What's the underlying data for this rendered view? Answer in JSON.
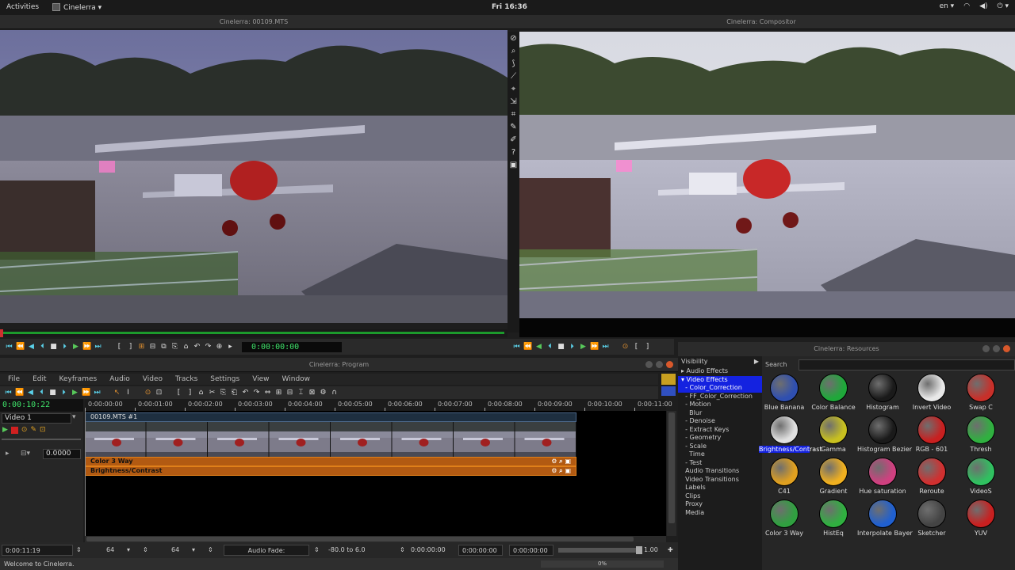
{
  "topbar": {
    "activities": "Activities",
    "app": "Cinelerra ▾",
    "clock": "Fri 16:36",
    "lang": "en ▾",
    "tray_icons": [
      "wifi-icon",
      "volume-icon",
      "power-icon"
    ]
  },
  "viewer": {
    "title": "Cinelerra: 00109.MTS",
    "timecode": "0:00:00:00"
  },
  "compositor": {
    "title": "Cinelerra: Compositor"
  },
  "program": {
    "title": "Cinelerra: Program",
    "menu": [
      "File",
      "Edit",
      "Keyframes",
      "Audio",
      "Video",
      "Tracks",
      "Settings",
      "View",
      "Window"
    ],
    "position": "0:00:10:22",
    "ruler_labels": [
      "0:00:00:00",
      "0:00:01:00",
      "0:00:02:00",
      "0:00:03:00",
      "0:00:04:00",
      "0:00:05:00",
      "0:00:06:00",
      "0:00:07:00",
      "0:00:08:00",
      "0:00:09:00",
      "0:00:10:00",
      "0:00:11:00"
    ],
    "track": {
      "name": "Video 1",
      "fade": "0.0000",
      "clip_title": "00109.MTS #1",
      "effects": [
        "Color 3 Way",
        "Brightness/Contrast"
      ]
    },
    "status": {
      "duration": "0:00:11:19",
      "zoom1": "64",
      "zoom2": "64",
      "mode": "Audio Fade:",
      "range": "-80.0 to 6.0",
      "sel1": "0:00:00:00",
      "sel2": "0:00:00:00",
      "sel3": "0:00:00:00",
      "value": "1.00"
    },
    "welcome": "Welcome to Cinelerra.",
    "progress": "0%"
  },
  "resources": {
    "title": "Cinelerra: Resources",
    "visibility": "Visibility",
    "search_label": "Search",
    "tree": [
      {
        "label": "▸ Audio Effects",
        "sel": false
      },
      {
        "label": "▾ Video Effects",
        "sel": true
      },
      {
        "label": "  - Color_Correction",
        "sel": true
      },
      {
        "label": "  - FF_Color_Correction",
        "sel": false
      },
      {
        "label": "  - Motion",
        "sel": false
      },
      {
        "label": "    Blur",
        "sel": false
      },
      {
        "label": "  - Denoise",
        "sel": false
      },
      {
        "label": "  - Extract Keys",
        "sel": false
      },
      {
        "label": "  - Geometry",
        "sel": false
      },
      {
        "label": "  - Scale",
        "sel": false
      },
      {
        "label": "    Time",
        "sel": false
      },
      {
        "label": "  - Test",
        "sel": false
      },
      {
        "label": "  Audio Transitions",
        "sel": false
      },
      {
        "label": "  Video Transitions",
        "sel": false
      },
      {
        "label": "  Labels",
        "sel": false
      },
      {
        "label": "  Clips",
        "sel": false
      },
      {
        "label": "  Proxy",
        "sel": false
      },
      {
        "label": "  Media",
        "sel": false
      }
    ],
    "effects": [
      {
        "label": "Blue Banana",
        "icon": "blue-banana-icon",
        "color": "#2f4fb0",
        "sel": false
      },
      {
        "label": "Color Balance",
        "icon": "color-balance-icon",
        "color": "#1fa83a",
        "sel": false
      },
      {
        "label": "Histogram",
        "icon": "histogram-icon",
        "color": "#1a1a1a",
        "sel": false
      },
      {
        "label": "Invert Video",
        "icon": "invert-video-icon",
        "color": "#e8e8e8",
        "sel": false
      },
      {
        "label": "Swap C",
        "icon": "swap-channels-icon",
        "color": "#c8302a",
        "sel": false
      },
      {
        "label": "Brightness/Contrast",
        "icon": "brightness-contrast-icon",
        "color": "#e0e0e0",
        "sel": true
      },
      {
        "label": "Gamma",
        "icon": "gamma-icon",
        "color": "#c8c020",
        "sel": false
      },
      {
        "label": "Histogram Bezier",
        "icon": "histogram-bezier-icon",
        "color": "#1a1a1a",
        "sel": false
      },
      {
        "label": "RGB - 601",
        "icon": "rgb-601-icon",
        "color": "#c82020",
        "sel": false
      },
      {
        "label": "Thresh",
        "icon": "threshold-icon",
        "color": "#30b040",
        "sel": false
      },
      {
        "label": "C41",
        "icon": "c41-icon",
        "color": "#e0a020",
        "sel": false
      },
      {
        "label": "Gradient",
        "icon": "gradient-icon",
        "color": "#f0b020",
        "sel": false
      },
      {
        "label": "Hue saturation",
        "icon": "hue-saturation-icon",
        "color": "#d04080",
        "sel": false
      },
      {
        "label": "Reroute",
        "icon": "reroute-icon",
        "color": "#d03030",
        "sel": false
      },
      {
        "label": "VideoS",
        "icon": "videoscope-icon",
        "color": "#30c060",
        "sel": false
      },
      {
        "label": "Color 3 Way",
        "icon": "color-3-way-icon",
        "color": "#30a040",
        "sel": false
      },
      {
        "label": "HistEq",
        "icon": "histeq-icon",
        "color": "#30b040",
        "sel": false
      },
      {
        "label": "Interpolate Bayer",
        "icon": "interpolate-bayer-icon",
        "color": "#2060d0",
        "sel": false
      },
      {
        "label": "Sketcher",
        "icon": "sketcher-icon",
        "color": "#444444",
        "sel": false
      },
      {
        "label": "YUV",
        "icon": "yuv-icon",
        "color": "#c82020",
        "sel": false
      }
    ]
  },
  "colors": {
    "accent_green": "#3fe36a",
    "selection_blue": "#1422e0",
    "effect_orange": "#b25a12",
    "transport_cyan": "#5ad0e8"
  }
}
